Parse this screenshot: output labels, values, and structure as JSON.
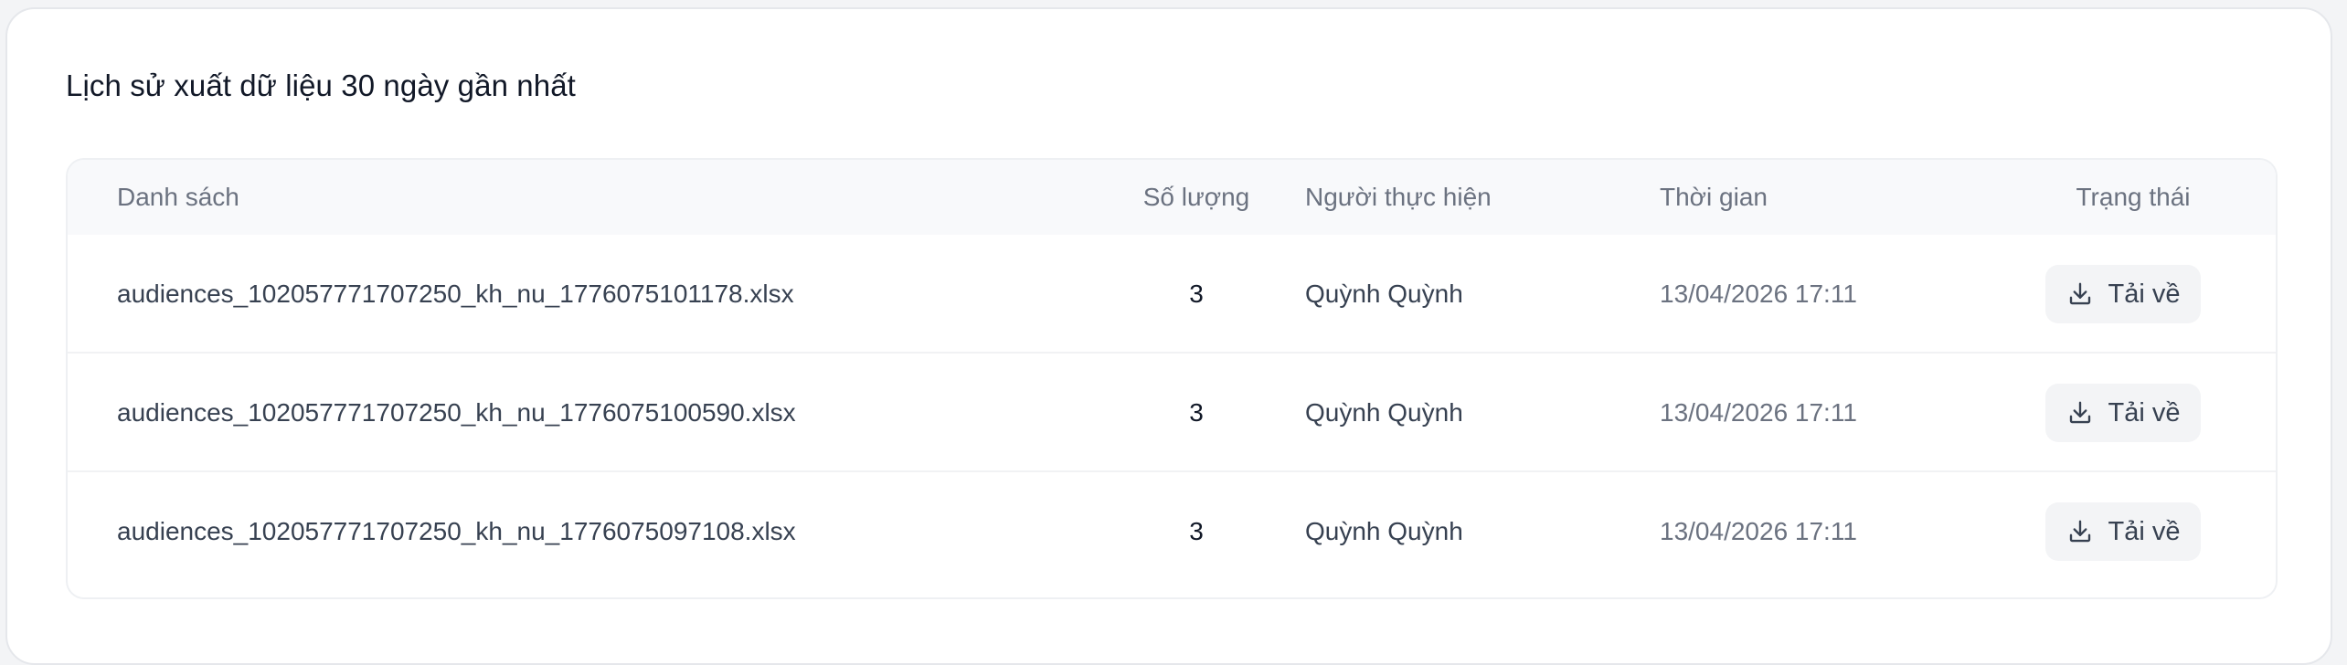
{
  "section": {
    "title": "Lịch sử xuất dữ liệu 30 ngày gần nhất"
  },
  "table": {
    "headers": {
      "name": "Danh sách",
      "quantity": "Số lượng",
      "performer": "Người thực hiện",
      "time": "Thời gian",
      "status": "Trạng thái"
    },
    "rows": [
      {
        "name": "audiences_102057771707250_kh_nu_1776075101178.xlsx",
        "quantity": "3",
        "performer": "Quỳnh Quỳnh",
        "time": "13/04/2026 17:11",
        "action_label": "Tải về"
      },
      {
        "name": "audiences_102057771707250_kh_nu_1776075100590.xlsx",
        "quantity": "3",
        "performer": "Quỳnh Quỳnh",
        "time": "13/04/2026 17:11",
        "action_label": "Tải về"
      },
      {
        "name": "audiences_102057771707250_kh_nu_1776075097108.xlsx",
        "quantity": "3",
        "performer": "Quỳnh Quỳnh",
        "time": "13/04/2026 17:11",
        "action_label": "Tải về"
      }
    ]
  },
  "icons": {
    "download": "download-icon"
  },
  "colors": {
    "header_bg": "#f8f9fb",
    "button_bg": "#f3f4f6",
    "muted_text": "#6b7280"
  }
}
